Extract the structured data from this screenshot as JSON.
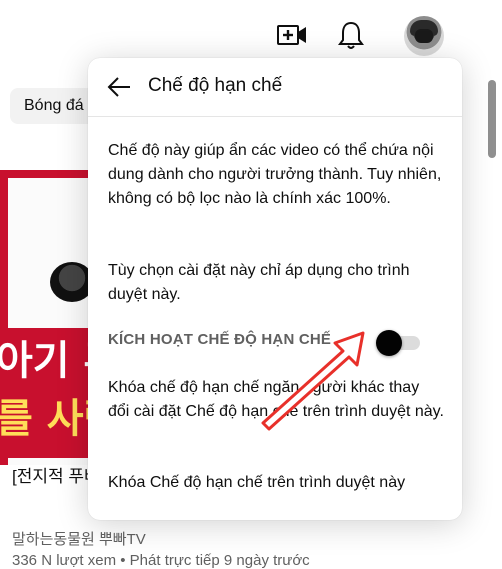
{
  "topbar": {
    "create_icon": "create-video-icon",
    "notifications_icon": "bell-icon",
    "avatar": "user-avatar"
  },
  "chip": {
    "label": "Bóng đá"
  },
  "video": {
    "thumbnail_text_1": "아기 푸",
    "thumbnail_text_2": "를 사람",
    "title": "[전지적 푸바오 길",
    "channel": "말하는동물원 뿌빠TV",
    "meta": "336 N lượt xem • Phát trực tiếp 9 ngày trước"
  },
  "menu": {
    "title": "Chế độ hạn chế",
    "back_icon": "arrow-left-icon",
    "description": "Chế độ này giúp ẩn các video có thể chứa nội dung dành cho người trưởng thành. Tuy nhiên, không có bộ lọc nào là chính xác 100%.",
    "scope_note": "Tùy chọn cài đặt này chỉ áp dụng cho trình duyệt này.",
    "toggle_label": "KÍCH HOẠT CHẾ ĐỘ HẠN CHẾ",
    "toggle_state": "off",
    "lock_description": "Khóa chế độ hạn chế ngăn người khác thay đổi cài đặt Chế độ hạn chế trên trình duyệt này.",
    "lock_action": "Khóa Chế độ hạn chế trên trình duyệt này"
  },
  "annotation": {
    "arrow_color": "#e8302a"
  }
}
